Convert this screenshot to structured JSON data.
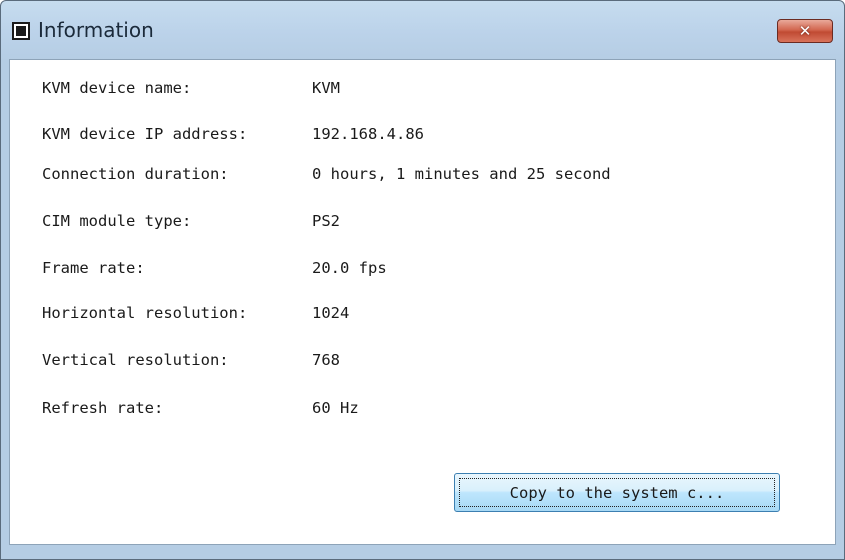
{
  "window": {
    "title": "Information",
    "close_glyph": "✕"
  },
  "info_rows": [
    {
      "label": "KVM device name:",
      "value": "KVM"
    },
    {
      "label": "KVM device IP address:",
      "value": "192.168.4.86"
    },
    {
      "label": "Connection duration:",
      "value": "0 hours, 1 minutes and 25 second"
    },
    {
      "label": "CIM module type:",
      "value": "PS2"
    },
    {
      "label": "Frame rate:",
      "value": "20.0 fps"
    },
    {
      "label": "Horizontal resolution:",
      "value": "1024"
    },
    {
      "label": "Vertical resolution:",
      "value": "768"
    },
    {
      "label": "Refresh rate:",
      "value": "60 Hz"
    }
  ],
  "buttons": {
    "copy_label": "Copy to the system c..."
  },
  "icons": {
    "window_icon": "window-icon",
    "close": "close-icon"
  }
}
